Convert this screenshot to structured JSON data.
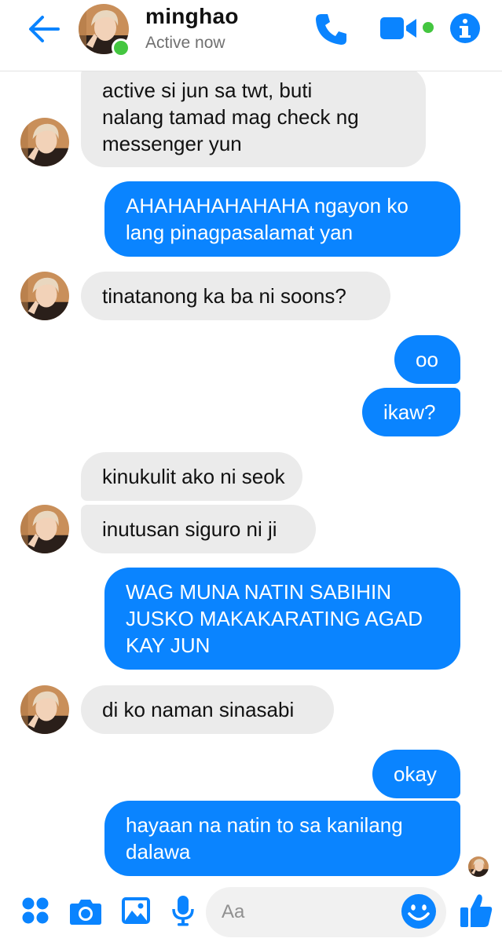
{
  "header": {
    "name": "minghao",
    "status": "Active now"
  },
  "messages": [
    {
      "from": "them",
      "text": "active si jun sa twt, buti\nnalang tamad mag check ng\nmessenger yun"
    },
    {
      "from": "me",
      "text": "AHAHAHAHAHAHA ngayon ko\nlang pinagpasalamat yan"
    },
    {
      "from": "them",
      "text": "tinatanong ka ba ni soons?"
    },
    {
      "from": "me",
      "text": "oo"
    },
    {
      "from": "me",
      "text": "ikaw?"
    },
    {
      "from": "them",
      "text": "kinukulit ako ni seok"
    },
    {
      "from": "them",
      "text": "inutusan siguro ni ji"
    },
    {
      "from": "me",
      "text": "WAG MUNA NATIN SABIHIN\nJUSKO MAKAKARATING AGAD\nKAY JUN"
    },
    {
      "from": "them",
      "text": "di ko naman sinasabi"
    },
    {
      "from": "me",
      "text": "okay"
    },
    {
      "from": "me",
      "text": "hayaan na natin to sa kanilang\ndalawa"
    }
  ],
  "composer": {
    "placeholder": "Aa"
  },
  "colors": {
    "accent": "#0a84ff",
    "incoming_bubble": "#ebebeb",
    "online": "#44c640"
  },
  "icons": [
    "back-arrow-icon",
    "phone-icon",
    "video-camera-icon",
    "info-icon",
    "apps-icon",
    "camera-icon",
    "image-icon",
    "microphone-icon",
    "emoji-icon",
    "thumbs-up-icon"
  ]
}
